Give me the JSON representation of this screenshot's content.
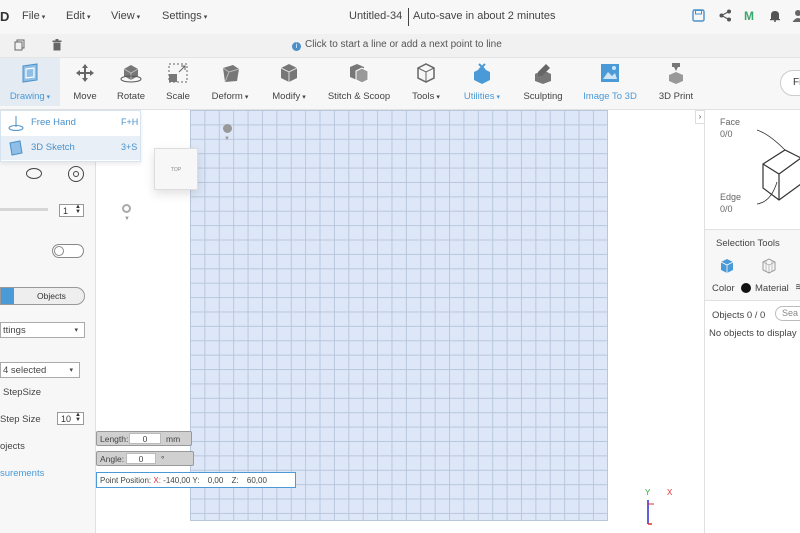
{
  "app": {
    "logo_letter": "D",
    "title": "Untitled-34",
    "autosave": "Auto-save in about 2 minutes"
  },
  "menu": [
    {
      "label": "File",
      "caret": "▾"
    },
    {
      "label": "Edit",
      "caret": "▾"
    },
    {
      "label": "View",
      "caret": "▾"
    },
    {
      "label": "Settings",
      "caret": "▾"
    }
  ],
  "top_icons": [
    "save-icon",
    "share-icon",
    "m-logo-icon",
    "bell-icon",
    "user-icon"
  ],
  "hint": {
    "text": "Click to start a line or add a next point to line",
    "icon": "info-icon"
  },
  "toolbar": {
    "tools": [
      {
        "label": "Drawing",
        "caret": "▾",
        "blue": true,
        "icon": "drawing-icon"
      },
      {
        "label": "Move",
        "caret": "",
        "blue": false,
        "icon": "move-icon"
      },
      {
        "label": "Rotate",
        "caret": "",
        "blue": false,
        "icon": "rotate-icon"
      },
      {
        "label": "Scale",
        "caret": "",
        "blue": false,
        "icon": "scale-icon"
      },
      {
        "label": "Deform",
        "caret": "▾",
        "blue": false,
        "icon": "deform-icon"
      },
      {
        "label": "Modify",
        "caret": "▾",
        "blue": false,
        "icon": "modify-icon"
      },
      {
        "label": "Stitch & Scoop",
        "caret": "",
        "blue": false,
        "icon": "stitch-scoop-icon"
      },
      {
        "label": "Tools",
        "caret": "▾",
        "blue": false,
        "icon": "tools-icon"
      },
      {
        "label": "Utilities",
        "caret": "▾",
        "blue": true,
        "icon": "utilities-icon"
      },
      {
        "label": "Sculpting",
        "caret": "",
        "blue": false,
        "icon": "sculpting-icon"
      },
      {
        "label": "Image To 3D",
        "caret": "",
        "blue": true,
        "icon": "image-to-3d-icon"
      },
      {
        "label": "3D Print",
        "caret": "",
        "blue": false,
        "icon": "3d-print-icon"
      }
    ],
    "right_button": "Fi"
  },
  "drawing_menu": [
    {
      "label": "Free Hand",
      "shortcut": "F+H"
    },
    {
      "label": "3D Sketch",
      "shortcut": "3+S"
    }
  ],
  "left_panel": {
    "step_value": "1",
    "objects_tab": "Objects",
    "settings_select": "ttings",
    "selected_select": "4 selected",
    "stepsize_label": "StepSize",
    "step_size_label": "Step Size",
    "step_size_value": "10",
    "objects_label": "ojects",
    "measurements_label": "surements"
  },
  "viewport": {
    "viewcube_label": "TOP",
    "length_label": "Length:",
    "length_value": "0",
    "length_unit": "mm",
    "angle_label": "Angle:",
    "angle_value": "0",
    "angle_unit": "°",
    "point_label": "Point Position:",
    "x_label": "X:",
    "x_value": "-140,00",
    "y_label": "Y:",
    "y_value": "0,00",
    "z_label": "Z:",
    "z_value": "60,00",
    "axis_y": "Y",
    "axis_x": "X"
  },
  "right_panel": {
    "face_label": "Face",
    "face_value": "0/0",
    "edge_label": "Edge",
    "edge_value": "0/0",
    "selection_tools": "Selection Tools",
    "color_label": "Color",
    "material_label": "Material",
    "objects_count": "Objects 0 / 0",
    "search_placeholder": "Sea",
    "no_objects": "No objects to display"
  },
  "colors": {
    "accent": "#4a9ad8",
    "grid_fill": "#dde7f7",
    "grid_line": "#b9c7dd"
  }
}
